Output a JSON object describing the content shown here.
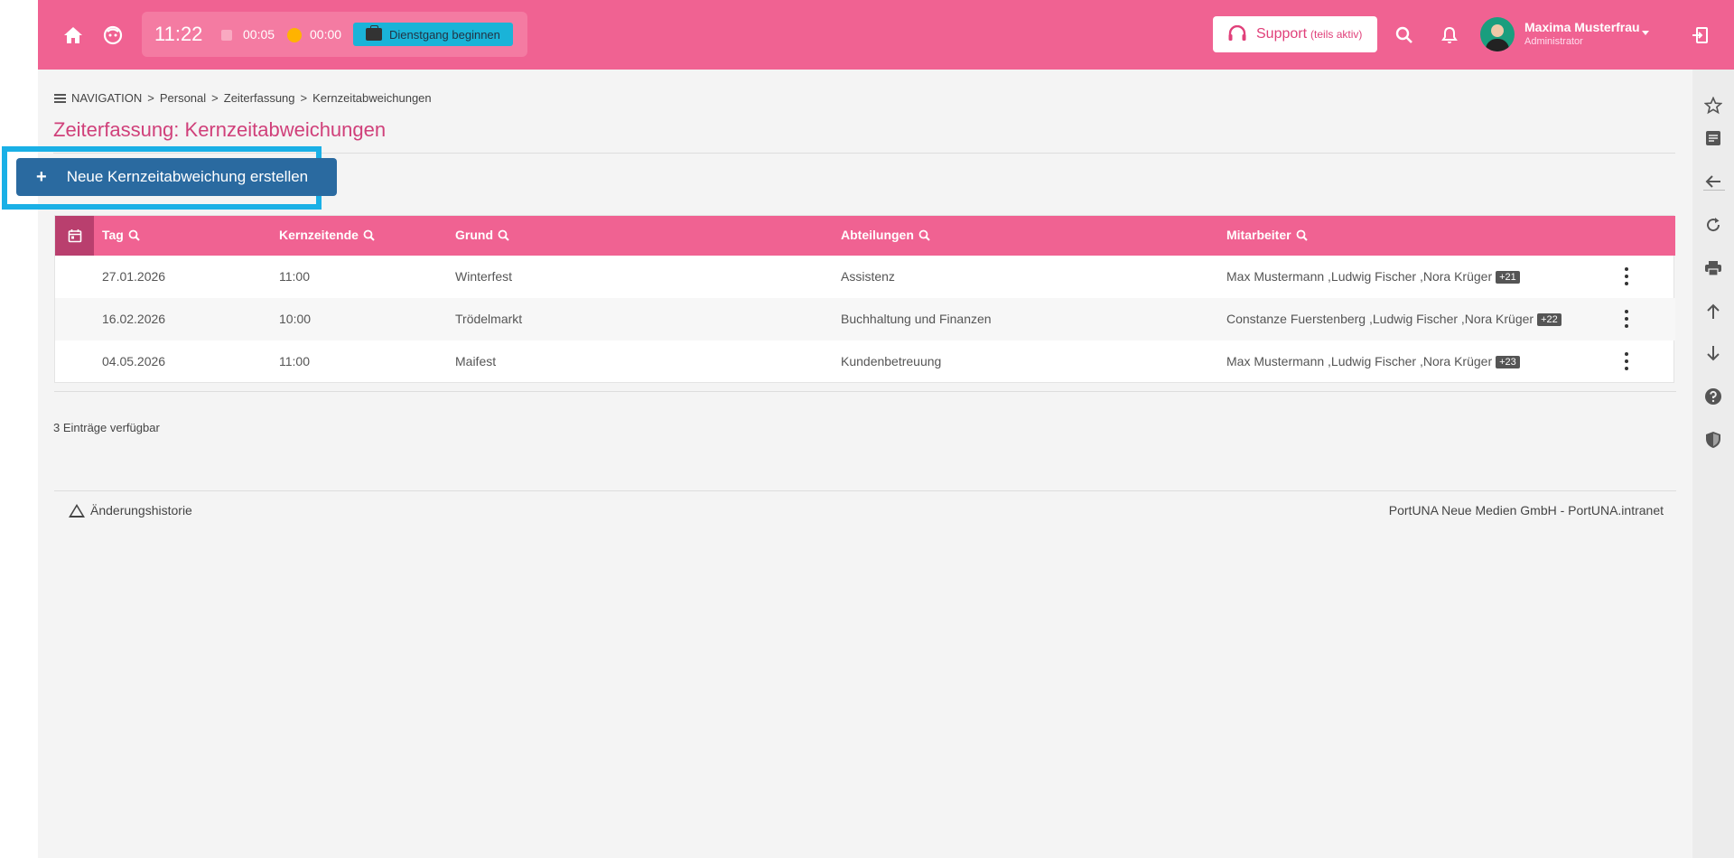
{
  "colors": {
    "brand": "#f06292",
    "accent_dark": "#b93f6e",
    "primary_button": "#2a6aa0",
    "highlight": "#1ab0e6",
    "dienst_button": "#1ab3d8"
  },
  "header": {
    "clock": "11:22",
    "pause_time": "00:05",
    "bonus_time": "00:00",
    "dienstgang_label": "Dienstgang beginnen",
    "support_label": "Support",
    "support_sub": "(teils aktiv)",
    "user_name": "Maxima Musterfrau",
    "user_role": "Administrator",
    "icons": [
      "home-icon",
      "face-icon",
      "search-icon",
      "bell-icon",
      "logout-icon"
    ]
  },
  "breadcrumb": {
    "items": [
      "NAVIGATION",
      "Personal",
      "Zeiterfassung",
      "Kernzeitabweichungen"
    ],
    "separator": ">"
  },
  "page_title": "Zeiterfassung: Kernzeitabweichungen",
  "new_button": {
    "plus": "+",
    "label": "Neue Kernzeitabweichung erstellen"
  },
  "table": {
    "columns": [
      "Tag",
      "Kernzeitende",
      "Grund",
      "Abteilungen",
      "Mitarbeiter"
    ],
    "rows": [
      {
        "tag": "27.01.2026",
        "ende": "11:00",
        "grund": "Winterfest",
        "abteilung": "Assistenz",
        "mitarbeiter": "Max Mustermann ,Ludwig Fischer ,Nora Krüger",
        "more": "+21"
      },
      {
        "tag": "16.02.2026",
        "ende": "10:00",
        "grund": "Trödelmarkt",
        "abteilung": "Buchhaltung und Finanzen",
        "mitarbeiter": "Constanze Fuerstenberg ,Ludwig Fischer ,Nora Krüger",
        "more": "+22"
      },
      {
        "tag": "04.05.2026",
        "ende": "11:00",
        "grund": "Maifest",
        "abteilung": "Kundenbetreuung",
        "mitarbeiter": "Max Mustermann ,Ludwig Fischer ,Nora Krüger",
        "more": "+23"
      }
    ]
  },
  "entries_count": "3 Einträge verfügbar",
  "footer": {
    "history_label": "Änderungshistorie",
    "company": "PortUNA Neue Medien GmbH - PortUNA.intranet"
  },
  "right_sidebar_icons": [
    "star-icon",
    "note-icon",
    "back-arrow-icon",
    "refresh-icon",
    "print-icon",
    "arrow-up-icon",
    "arrow-down-icon",
    "help-icon",
    "shield-icon"
  ]
}
